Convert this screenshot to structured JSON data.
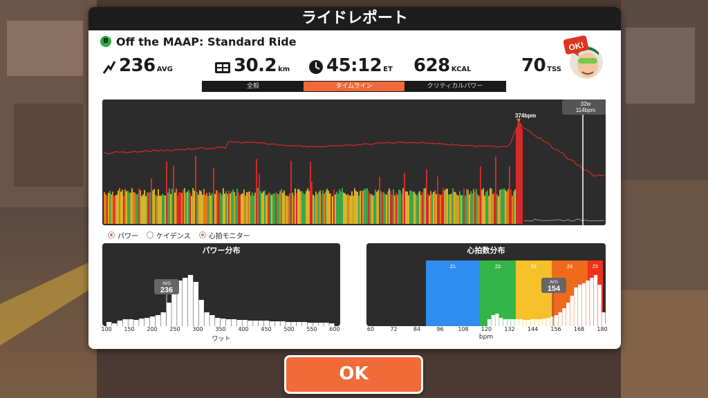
{
  "window": {
    "title": "ライドレポート"
  },
  "ride": {
    "badge": "B",
    "name": "Off the MAAP: Standard Ride"
  },
  "stats": {
    "power": {
      "value": "236",
      "unit": "AVG"
    },
    "distance": {
      "value": "30.2",
      "unit": "km"
    },
    "time": {
      "value": "45:12",
      "unit": "ET"
    },
    "calories": {
      "value": "628",
      "unit": "KCAL"
    },
    "tss": {
      "value": "70",
      "unit": "TSS"
    }
  },
  "avatar": {
    "bubble": "OK!"
  },
  "tabs": [
    {
      "label": "全般",
      "active": false
    },
    {
      "label": "タイムライン",
      "active": true
    },
    {
      "label": "クリティカルパワー",
      "active": false
    }
  ],
  "timeline": {
    "peak_label": "374bpm",
    "cursor": {
      "line1": "32w",
      "line2": "114bpm"
    }
  },
  "legend": [
    {
      "label": "パワー",
      "checked": true
    },
    {
      "label": "ケイデンス",
      "checked": false
    },
    {
      "label": "心拍モニター",
      "checked": true
    }
  ],
  "power_dist": {
    "title": "パワー分布",
    "avg_label": "AVG",
    "avg_value": "236",
    "x_ticks": [
      "100",
      "150",
      "200",
      "250",
      "300",
      "350",
      "400",
      "450",
      "500",
      "550",
      "600"
    ],
    "x_title": "ワット"
  },
  "hr_dist": {
    "title": "心拍数分布",
    "avg_label": "AVG",
    "avg_value": "154",
    "zones": [
      {
        "name": "Z1",
        "color": "#2f8df0"
      },
      {
        "name": "Z2",
        "color": "#34b54a"
      },
      {
        "name": "Z3",
        "color": "#f6c12b"
      },
      {
        "name": "Z4",
        "color": "#f06a1c"
      },
      {
        "name": "Z5",
        "color": "#f0311b"
      }
    ],
    "x_ticks": [
      "60",
      "72",
      "84",
      "96",
      "108",
      "120",
      "132",
      "144",
      "156",
      "168",
      "180"
    ],
    "x_title": "bpm"
  },
  "ok_button": {
    "label": "OK"
  },
  "colors": {
    "accent": "#f06a3a",
    "heart_rate_line": "#d42a2a"
  }
}
